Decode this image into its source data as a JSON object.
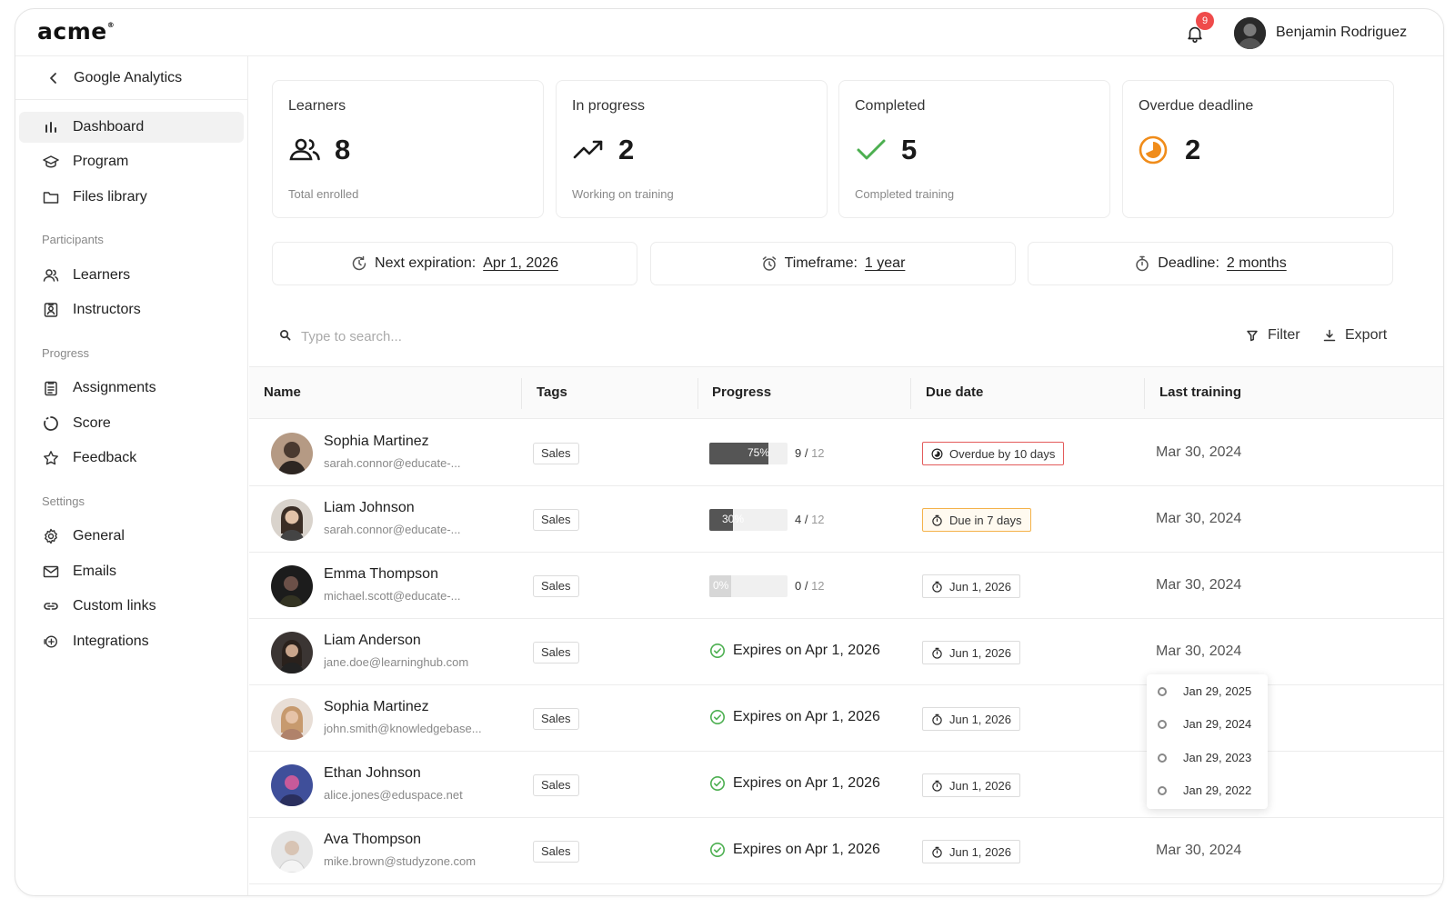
{
  "app": {
    "logo": "acme"
  },
  "header": {
    "notification_count": "9",
    "user_name": "Benjamin Rodriguez"
  },
  "sidebar": {
    "back_label": "Google Analytics",
    "items": [
      {
        "label": "Dashboard",
        "icon": "bar-chart-icon",
        "active": true
      },
      {
        "label": "Program",
        "icon": "graduation-cap-icon"
      },
      {
        "label": "Files library",
        "icon": "folder-icon"
      }
    ],
    "sections": [
      {
        "title": "Participants",
        "items": [
          {
            "label": "Learners",
            "icon": "users-icon"
          },
          {
            "label": "Instructors",
            "icon": "id-badge-icon"
          }
        ]
      },
      {
        "title": "Progress",
        "items": [
          {
            "label": "Assignments",
            "icon": "clipboard-icon"
          },
          {
            "label": "Score",
            "icon": "circle-progress-icon"
          },
          {
            "label": "Feedback",
            "icon": "star-icon"
          }
        ]
      },
      {
        "title": "Settings",
        "items": [
          {
            "label": "General",
            "icon": "gear-icon"
          },
          {
            "label": "Emails",
            "icon": "mail-icon"
          },
          {
            "label": "Custom links",
            "icon": "link-icon"
          },
          {
            "label": "Integrations",
            "icon": "plus-circle-icon"
          }
        ]
      }
    ]
  },
  "stats": [
    {
      "title": "Learners",
      "value": "8",
      "subtitle": "Total enrolled",
      "icon": "users-icon"
    },
    {
      "title": "In progress",
      "value": "2",
      "subtitle": "Working on training",
      "icon": "trending-up-icon"
    },
    {
      "title": "Completed",
      "value": "5",
      "subtitle": "Completed training",
      "icon": "check-icon",
      "color": "#4caf50"
    },
    {
      "title": "Overdue deadline",
      "value": "2",
      "subtitle": "",
      "icon": "overdue-clock-icon",
      "color": "#f08c1a"
    }
  ],
  "pills": [
    {
      "label": "Next expiration:",
      "value": "Apr 1, 2026",
      "icon": "refresh-clock-icon"
    },
    {
      "label": "Timeframe:",
      "value": "1 year",
      "icon": "alarm-icon"
    },
    {
      "label": "Deadline:",
      "value": "2 months",
      "icon": "stopwatch-icon"
    }
  ],
  "search": {
    "placeholder": "Type to search..."
  },
  "toolbar": {
    "filter_label": "Filter",
    "export_label": "Export"
  },
  "table": {
    "columns": [
      "Name",
      "Tags",
      "Progress",
      "Due date",
      "Last training"
    ],
    "rows": [
      {
        "name": "Sophia Martinez",
        "email": "sarah.connor@educate-...",
        "tag": "Sales",
        "progress_pct": "75%",
        "done": "9",
        "total": "12",
        "due": "Overdue by 10 days",
        "due_style": "red",
        "last": "Mar 30, 2024"
      },
      {
        "name": "Liam Johnson",
        "email": "sarah.connor@educate-...",
        "tag": "Sales",
        "progress_pct": "30%",
        "done": "4",
        "total": "12",
        "due": "Due in 7 days",
        "due_style": "orange",
        "last": "Mar 30, 2024"
      },
      {
        "name": "Emma Thompson",
        "email": "michael.scott@educate-...",
        "tag": "Sales",
        "progress_pct": "0%",
        "done": "0",
        "total": "12",
        "due": "Jun 1, 2026",
        "due_style": "plain",
        "last": "Mar 30, 2024"
      },
      {
        "name": "Liam Anderson",
        "email": "jane.doe@learninghub.com",
        "tag": "Sales",
        "expires": "Expires on Apr 1, 2026",
        "due": "Jun 1, 2026",
        "due_style": "plain",
        "last": "Mar 30, 2024"
      },
      {
        "name": "Sophia Martinez",
        "email": "john.smith@knowledgebase...",
        "tag": "Sales",
        "expires": "Expires on Apr 1, 2026",
        "due": "Jun 1, 2026",
        "due_style": "plain",
        "last": ""
      },
      {
        "name": "Ethan Johnson",
        "email": "alice.jones@eduspace.net",
        "tag": "Sales",
        "expires": "Expires on Apr 1, 2026",
        "due": "Jun 1, 2026",
        "due_style": "plain",
        "last": ""
      },
      {
        "name": "Ava Thompson",
        "email": "mike.brown@studyzone.com",
        "tag": "Sales",
        "expires": "Expires on Apr 1, 2026",
        "due": "Jun 1, 2026",
        "due_style": "plain",
        "last": "Mar 30, 2024"
      }
    ]
  },
  "history_popover": {
    "dates": [
      "Jan 29, 2025",
      "Jan 29, 2024",
      "Jan 29, 2023",
      "Jan 29, 2022"
    ]
  },
  "colors": {
    "overdue": "#e35b5b",
    "due_soon": "#f4b24a",
    "success": "#4caf50",
    "badge": "#ef4b4b"
  }
}
